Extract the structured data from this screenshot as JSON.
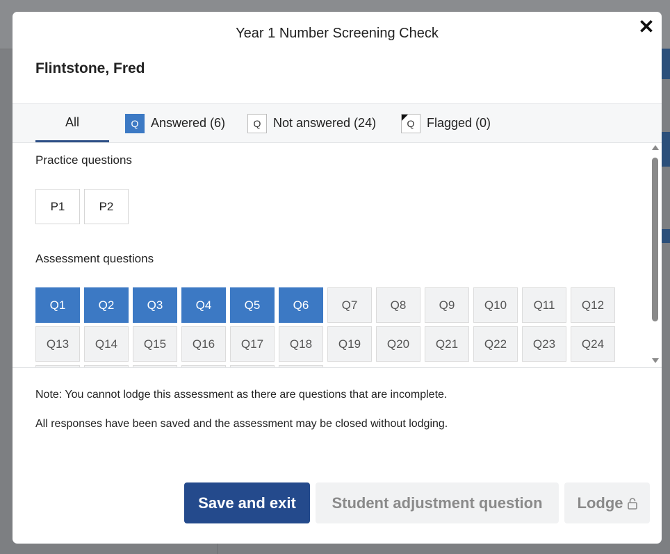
{
  "modal": {
    "title": "Year 1 Number Screening Check",
    "student_name": "Flintstone, Fred",
    "close_symbol": "✕"
  },
  "tabs": {
    "all": "All",
    "answered_badge": "Q",
    "answered": "Answered (6)",
    "not_answered_badge": "Q",
    "not_answered": "Not answered (24)",
    "flagged_badge": "Q",
    "flagged": "Flagged (0)"
  },
  "practice": {
    "label": "Practice questions",
    "items": [
      "P1",
      "P2"
    ]
  },
  "assessment": {
    "label": "Assessment questions",
    "answered": [
      "Q1",
      "Q2",
      "Q3",
      "Q4",
      "Q5",
      "Q6"
    ],
    "unanswered": [
      "Q7",
      "Q8",
      "Q9",
      "Q10",
      "Q11",
      "Q12",
      "Q13",
      "Q14",
      "Q15",
      "Q16",
      "Q17",
      "Q18",
      "Q19",
      "Q20",
      "Q21",
      "Q22",
      "Q23",
      "Q24"
    ]
  },
  "notes": {
    "incomplete": "Note: You cannot lodge this assessment as there are questions that are incomplete.",
    "saved": "All responses have been saved and the assessment may be closed without lodging."
  },
  "buttons": {
    "save_exit": "Save and exit",
    "student_adjustment": "Student adjustment question",
    "lodge": "Lodge"
  },
  "colors": {
    "answered": "#3c79c4",
    "primary_button": "#244a8c",
    "tab_underline": "#2d4f86"
  }
}
